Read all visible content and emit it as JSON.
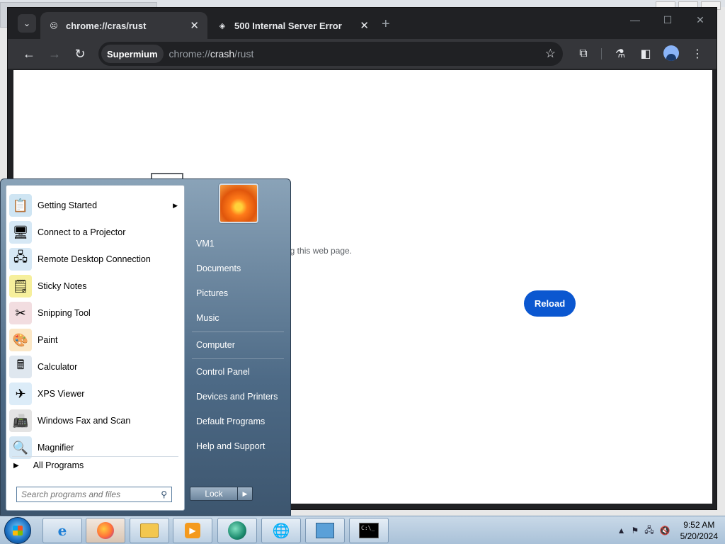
{
  "browser": {
    "tabs": [
      {
        "label": "chrome://cras/rust",
        "active": true
      },
      {
        "label": "500 Internal Server Error",
        "active": false
      }
    ],
    "new_tab": "+",
    "window_controls": {
      "minimize": "—",
      "maximize": "☐",
      "close": "✕"
    },
    "nav": {
      "back": "←",
      "forward": "→",
      "reload": "↻"
    },
    "site_chip": "Supermium",
    "url_prefix": "chrome://",
    "url_host": "crash",
    "url_path": "/rust",
    "icons": [
      "star-icon",
      "extensions-icon",
      "labs-icon",
      "side-panel-icon",
      "profile-icon",
      "menu-icon"
    ]
  },
  "page": {
    "error_text_fragment": "ng this web page.",
    "reload_label": "Reload"
  },
  "start_menu": {
    "programs": [
      {
        "label": "Getting Started",
        "icon": "getting-started-icon",
        "submenu": true
      },
      {
        "label": "Connect to a Projector",
        "icon": "projector-icon"
      },
      {
        "label": "Remote Desktop Connection",
        "icon": "remote-desktop-icon"
      },
      {
        "label": "Sticky Notes",
        "icon": "sticky-notes-icon"
      },
      {
        "label": "Snipping Tool",
        "icon": "snipping-tool-icon"
      },
      {
        "label": "Paint",
        "icon": "paint-icon"
      },
      {
        "label": "Calculator",
        "icon": "calculator-icon"
      },
      {
        "label": "XPS Viewer",
        "icon": "xps-viewer-icon"
      },
      {
        "label": "Windows Fax and Scan",
        "icon": "fax-scan-icon"
      },
      {
        "label": "Magnifier",
        "icon": "magnifier-icon"
      }
    ],
    "all_programs": "All Programs",
    "search_placeholder": "Search programs and files",
    "right_links": [
      "VM1",
      "Documents",
      "Pictures",
      "Music",
      "Computer",
      "Control Panel",
      "Devices and Printers",
      "Default Programs",
      "Help and Support"
    ],
    "lock_label": "Lock"
  },
  "taskbar": {
    "apps": [
      "internet-explorer-icon",
      "firefox-icon",
      "file-explorer-icon",
      "media-player-icon",
      "app-icon",
      "task-manager-icon",
      "control-panel-icon",
      "command-prompt-icon"
    ],
    "time": "9:52 AM",
    "date": "5/20/2024"
  }
}
